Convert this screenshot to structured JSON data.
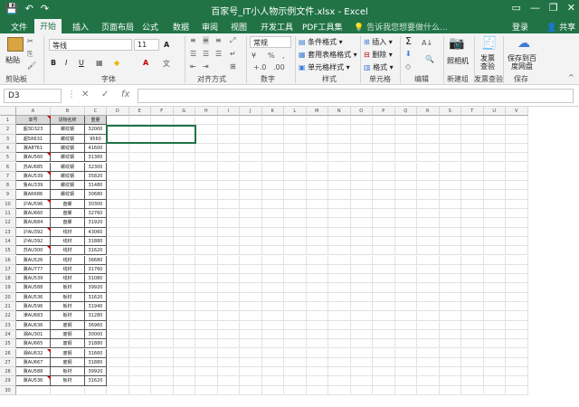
{
  "window": {
    "title": "百家号_IT小人物示例文件.xlsx - Excel",
    "minimize": "—",
    "restore": "❐",
    "close": "✕",
    "ribbon_toggle": "▭"
  },
  "qat": {
    "save": "💾",
    "undo": "↶",
    "redo": "↷"
  },
  "tabs": [
    "文件",
    "开始",
    "插入",
    "页面布局",
    "公式",
    "数据",
    "审阅",
    "视图",
    "开发工具",
    "PDF工具集"
  ],
  "active_tab": "开始",
  "tellme": "告诉我您想要做什么...",
  "account": {
    "login": "登录",
    "share": "共享"
  },
  "ribbon": {
    "paste": "粘贴",
    "clipboard": "剪贴板",
    "font_name": "等线",
    "font_size": "11",
    "font_group": "字体",
    "bold": "B",
    "italic": "I",
    "underline": "U",
    "grow": "A",
    "align_group": "对齐方式",
    "number_format": "常规",
    "number_group": "数字",
    "percent": "%",
    "comma": ",",
    "currency": "¥",
    "cond_format": "条件格式",
    "table_format": "套用表格格式",
    "cell_style": "单元格样式",
    "styles_group": "样式",
    "insert": "插入",
    "delete": "删除",
    "format": "格式",
    "cells_group": "单元格",
    "edit_group": "编辑",
    "sigma": "Σ",
    "camera": "照相机",
    "newgroup": "新建组",
    "invoice": "发票查验",
    "invoice_group": "发票查验",
    "save_cloud": "保存到百度网盘",
    "save_group": "保存"
  },
  "formula_bar": {
    "namebox": "D3",
    "cancel": "✕",
    "confirm": "✓",
    "fx": "fx",
    "value": ""
  },
  "columns": [
    "A",
    "B",
    "C",
    "D",
    "E",
    "F",
    "G",
    "H",
    "I",
    "J",
    "K",
    "L",
    "M",
    "N",
    "O",
    "P",
    "Q",
    "R",
    "S",
    "T",
    "U",
    "V"
  ],
  "header_row": [
    "单号",
    "货物名称",
    "重量"
  ],
  "rows": [
    [
      "超3D323",
      "螺纹钢",
      "32000"
    ],
    [
      "超5R631",
      "螺纹钢",
      "9560"
    ],
    [
      "冀A8T61",
      "螺纹钢",
      "41600"
    ],
    [
      "冀AU560",
      "螺纹钢",
      "31360"
    ],
    [
      "苏AU685",
      "螺纹钢",
      "32300"
    ],
    [
      "冀AU539",
      "螺纹钢",
      "35820"
    ],
    [
      "鲁AU339",
      "螺纹钢",
      "31480"
    ],
    [
      "冀AR686",
      "螺纹钢",
      "30680"
    ],
    [
      "沪AU596",
      "盘螺",
      "30300"
    ],
    [
      "冀AU660",
      "盘螺",
      "32760"
    ],
    [
      "冀AU684",
      "盘螺",
      "31920"
    ],
    [
      "沪AU392",
      "线材",
      "43060"
    ],
    [
      "沪AU392",
      "线材",
      "31880"
    ],
    [
      "苏AU300",
      "线材",
      "31620"
    ],
    [
      "冀AU526",
      "线材",
      "36680"
    ],
    [
      "冀AU777",
      "线材",
      "31760"
    ],
    [
      "冀AU539",
      "线材",
      "31080"
    ],
    [
      "冀AU588",
      "板材",
      "39920"
    ],
    [
      "冀AU536",
      "板材",
      "31620"
    ],
    [
      "冀AU596",
      "板材",
      "31940"
    ],
    [
      "津AU683",
      "板材",
      "31280"
    ],
    [
      "冀AU636",
      "废钢",
      "36960"
    ],
    [
      "湘AU301",
      "废钢",
      "30000"
    ],
    [
      "冀AU665",
      "废钢",
      "31880"
    ],
    [
      "湘AU632",
      "废钢",
      "31660"
    ],
    [
      "冀AU667",
      "废钢",
      "31880"
    ],
    [
      "冀AU588",
      "板材",
      "39920"
    ],
    [
      "冀AU536",
      "板材",
      "31620"
    ]
  ],
  "comment_rows": [
    1,
    5,
    7,
    10,
    13,
    15,
    26,
    29
  ]
}
